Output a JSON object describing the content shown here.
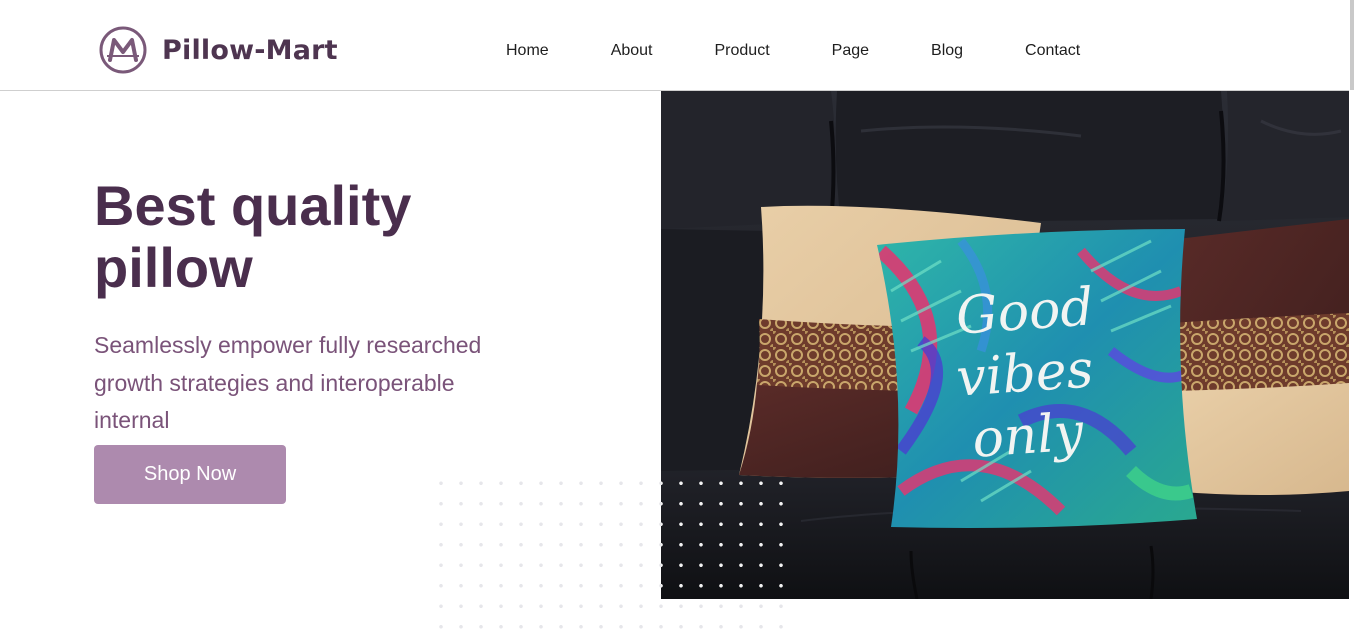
{
  "brand": {
    "name": "Pillow-Mart",
    "logo_letter": "M"
  },
  "nav": {
    "items": [
      {
        "label": "Home"
      },
      {
        "label": "About"
      },
      {
        "label": "Product"
      },
      {
        "label": "Page"
      },
      {
        "label": "Blog"
      },
      {
        "label": "Contact"
      }
    ]
  },
  "hero": {
    "title_line1": "Best quality",
    "title_line2": "pillow",
    "subtitle": "Seamlessly empower fully researched growth strategies and interoperable internal",
    "cta_label": "Shop Now",
    "photo_pillow_text": [
      "Good",
      "vibes",
      "only"
    ]
  },
  "colors": {
    "brand_purple": "#4a2e4d",
    "subtitle": "#7a5379",
    "button_bg": "#ad8aae",
    "sofa": "#1f2026"
  }
}
